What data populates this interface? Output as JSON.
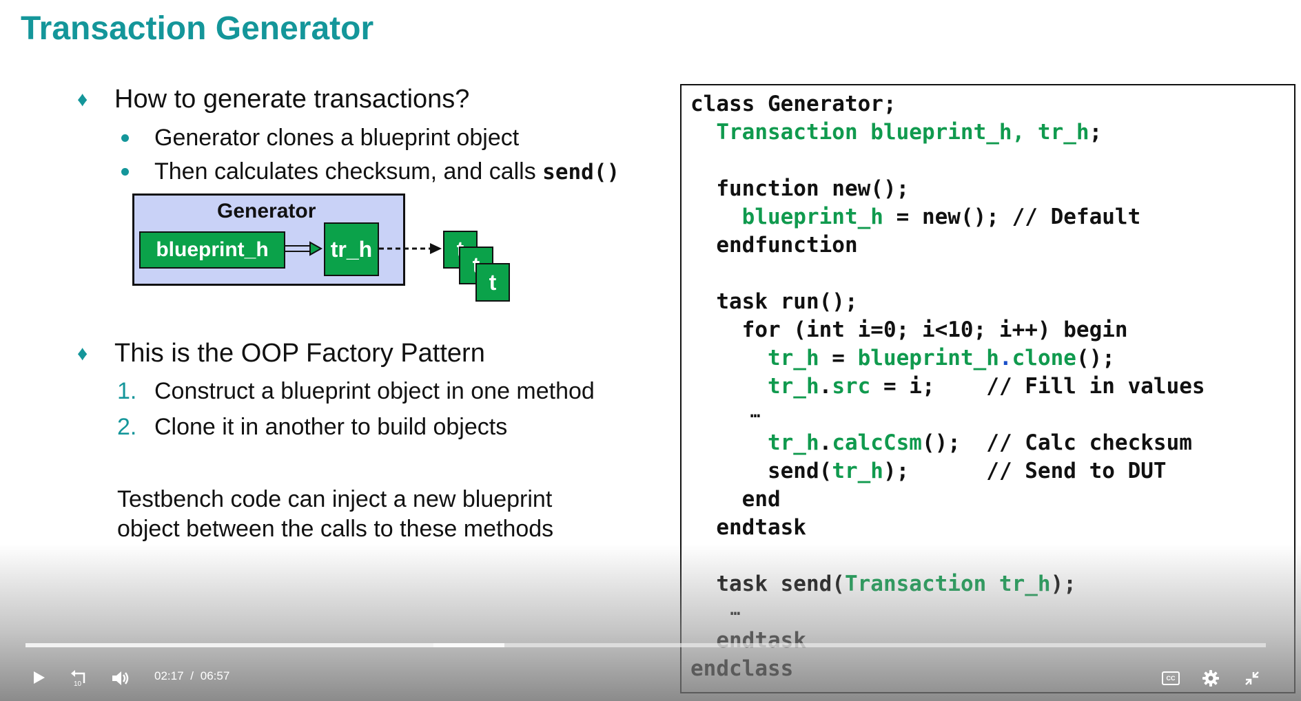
{
  "slide": {
    "title": "Transaction Generator",
    "bullet1": "How to generate transactions?",
    "sub1": "Generator clones a blueprint object",
    "sub2_prefix": "Then calculates checksum, and calls ",
    "sub2_code": "send()",
    "bullet2": "This is the OOP Factory Pattern",
    "steps": [
      {
        "num": "1.",
        "text": "Construct a blueprint object in one method"
      },
      {
        "num": "2.",
        "text": "Clone it in another to build objects"
      }
    ],
    "note_line1": "Testbench code can inject a new blueprint",
    "note_line2": "object between the calls to these methods"
  },
  "diagram": {
    "generator_label": "Generator",
    "blueprint_label": "blueprint_h",
    "tr_label": "tr_h",
    "stack_labels": [
      "t",
      "t",
      "t"
    ]
  },
  "code": {
    "l1": "class Generator;",
    "l2a": "  Transaction blueprint_h, tr_h",
    "l2b": ";",
    "l3": "  function new();",
    "l4a": "    blueprint_h",
    "l4b": " = new(); // Default",
    "l5": "  endfunction",
    "l6": "  task run();",
    "l7": "    for (int i=0; i<10; i++) begin",
    "l8a": "      tr_h",
    "l8b": " = ",
    "l8c": "blueprint_h",
    "l8d": ".",
    "l8e": "clone",
    "l8f": "();",
    "l9a": "      tr_h",
    "l9b": ".",
    "l9c": "src",
    "l9d": " = i;    // Fill in values",
    "l10": "      …",
    "l11a": "      tr_h",
    "l11b": ".",
    "l11c": "calcCsm",
    "l11d": "();  // Calc checksum",
    "l12a": "      send(",
    "l12b": "tr_h",
    "l12c": ");      // Send to DUT",
    "l13": "    end",
    "l14": "  endtask",
    "l15a": "  task send(",
    "l15b": "Transaction tr_h",
    "l15c": ");",
    "l16": "    …",
    "l17": "  endtask",
    "l18": "endclass"
  },
  "player": {
    "current_time": "02:17",
    "separator": "/",
    "duration": "06:57",
    "progress_fraction": 0.329,
    "buffered_fraction": 0.386,
    "icons": {
      "play": "play-icon",
      "rewind": "rewind-10-icon",
      "volume": "volume-icon",
      "captions": "captions-icon",
      "settings": "gear-icon",
      "fullscreen_exit": "exit-fullscreen-icon"
    },
    "captions_label": "CC",
    "rewind_label": "10"
  },
  "colors": {
    "accent_teal": "#14969a",
    "code_green": "#109a4e",
    "box_green": "#0ba24a",
    "generator_fill": "#c9d2f7"
  }
}
